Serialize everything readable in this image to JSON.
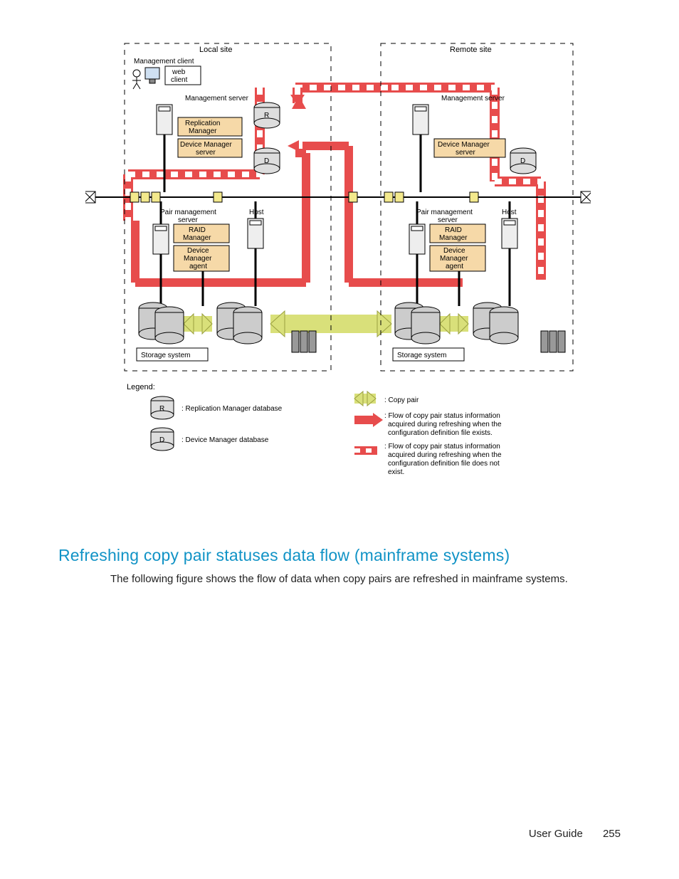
{
  "heading": "Refreshing copy pair statuses data flow (mainframe systems)",
  "body": "The following figure shows the flow of data when copy pairs are refreshed in mainframe systems.",
  "footer": {
    "label": "User Guide",
    "page": "255"
  },
  "diagram": {
    "localSite": "Local site",
    "remoteSite": "Remote site",
    "mgmtClient": "Management client",
    "webClient": "web client",
    "mgmtServerL": "Management server",
    "mgmtServerR": "Management server",
    "replMgr": "Replication Manager",
    "devMgrSrvL": "Device Manager server",
    "devMgrSrvR": "Device Manager server",
    "pairMgmtL": "Pair management server",
    "pairMgmtR": "Pair management server",
    "hostL": "Host",
    "hostR": "Host",
    "raidMgrL": "RAID Manager",
    "raidMgrR": "RAID Manager",
    "devMgrAgentL": "Device Manager agent",
    "devMgrAgentR": "Device Manager agent",
    "storageL": "Storage system",
    "storageR": "Storage system",
    "R": "R",
    "D": "D",
    "legendTitle": "Legend:",
    "legRepDb": ": Replication Manager database",
    "legDevDb": ": Device Manager database",
    "legCopyPair": ": Copy pair",
    "legFlowExists": ": Flow of copy pair status information acquired during refreshing when the configuration definition file exists.",
    "legFlowNotExist": ": Flow of copy pair status information acquired during refreshing when the configuration definition file does not exist."
  }
}
